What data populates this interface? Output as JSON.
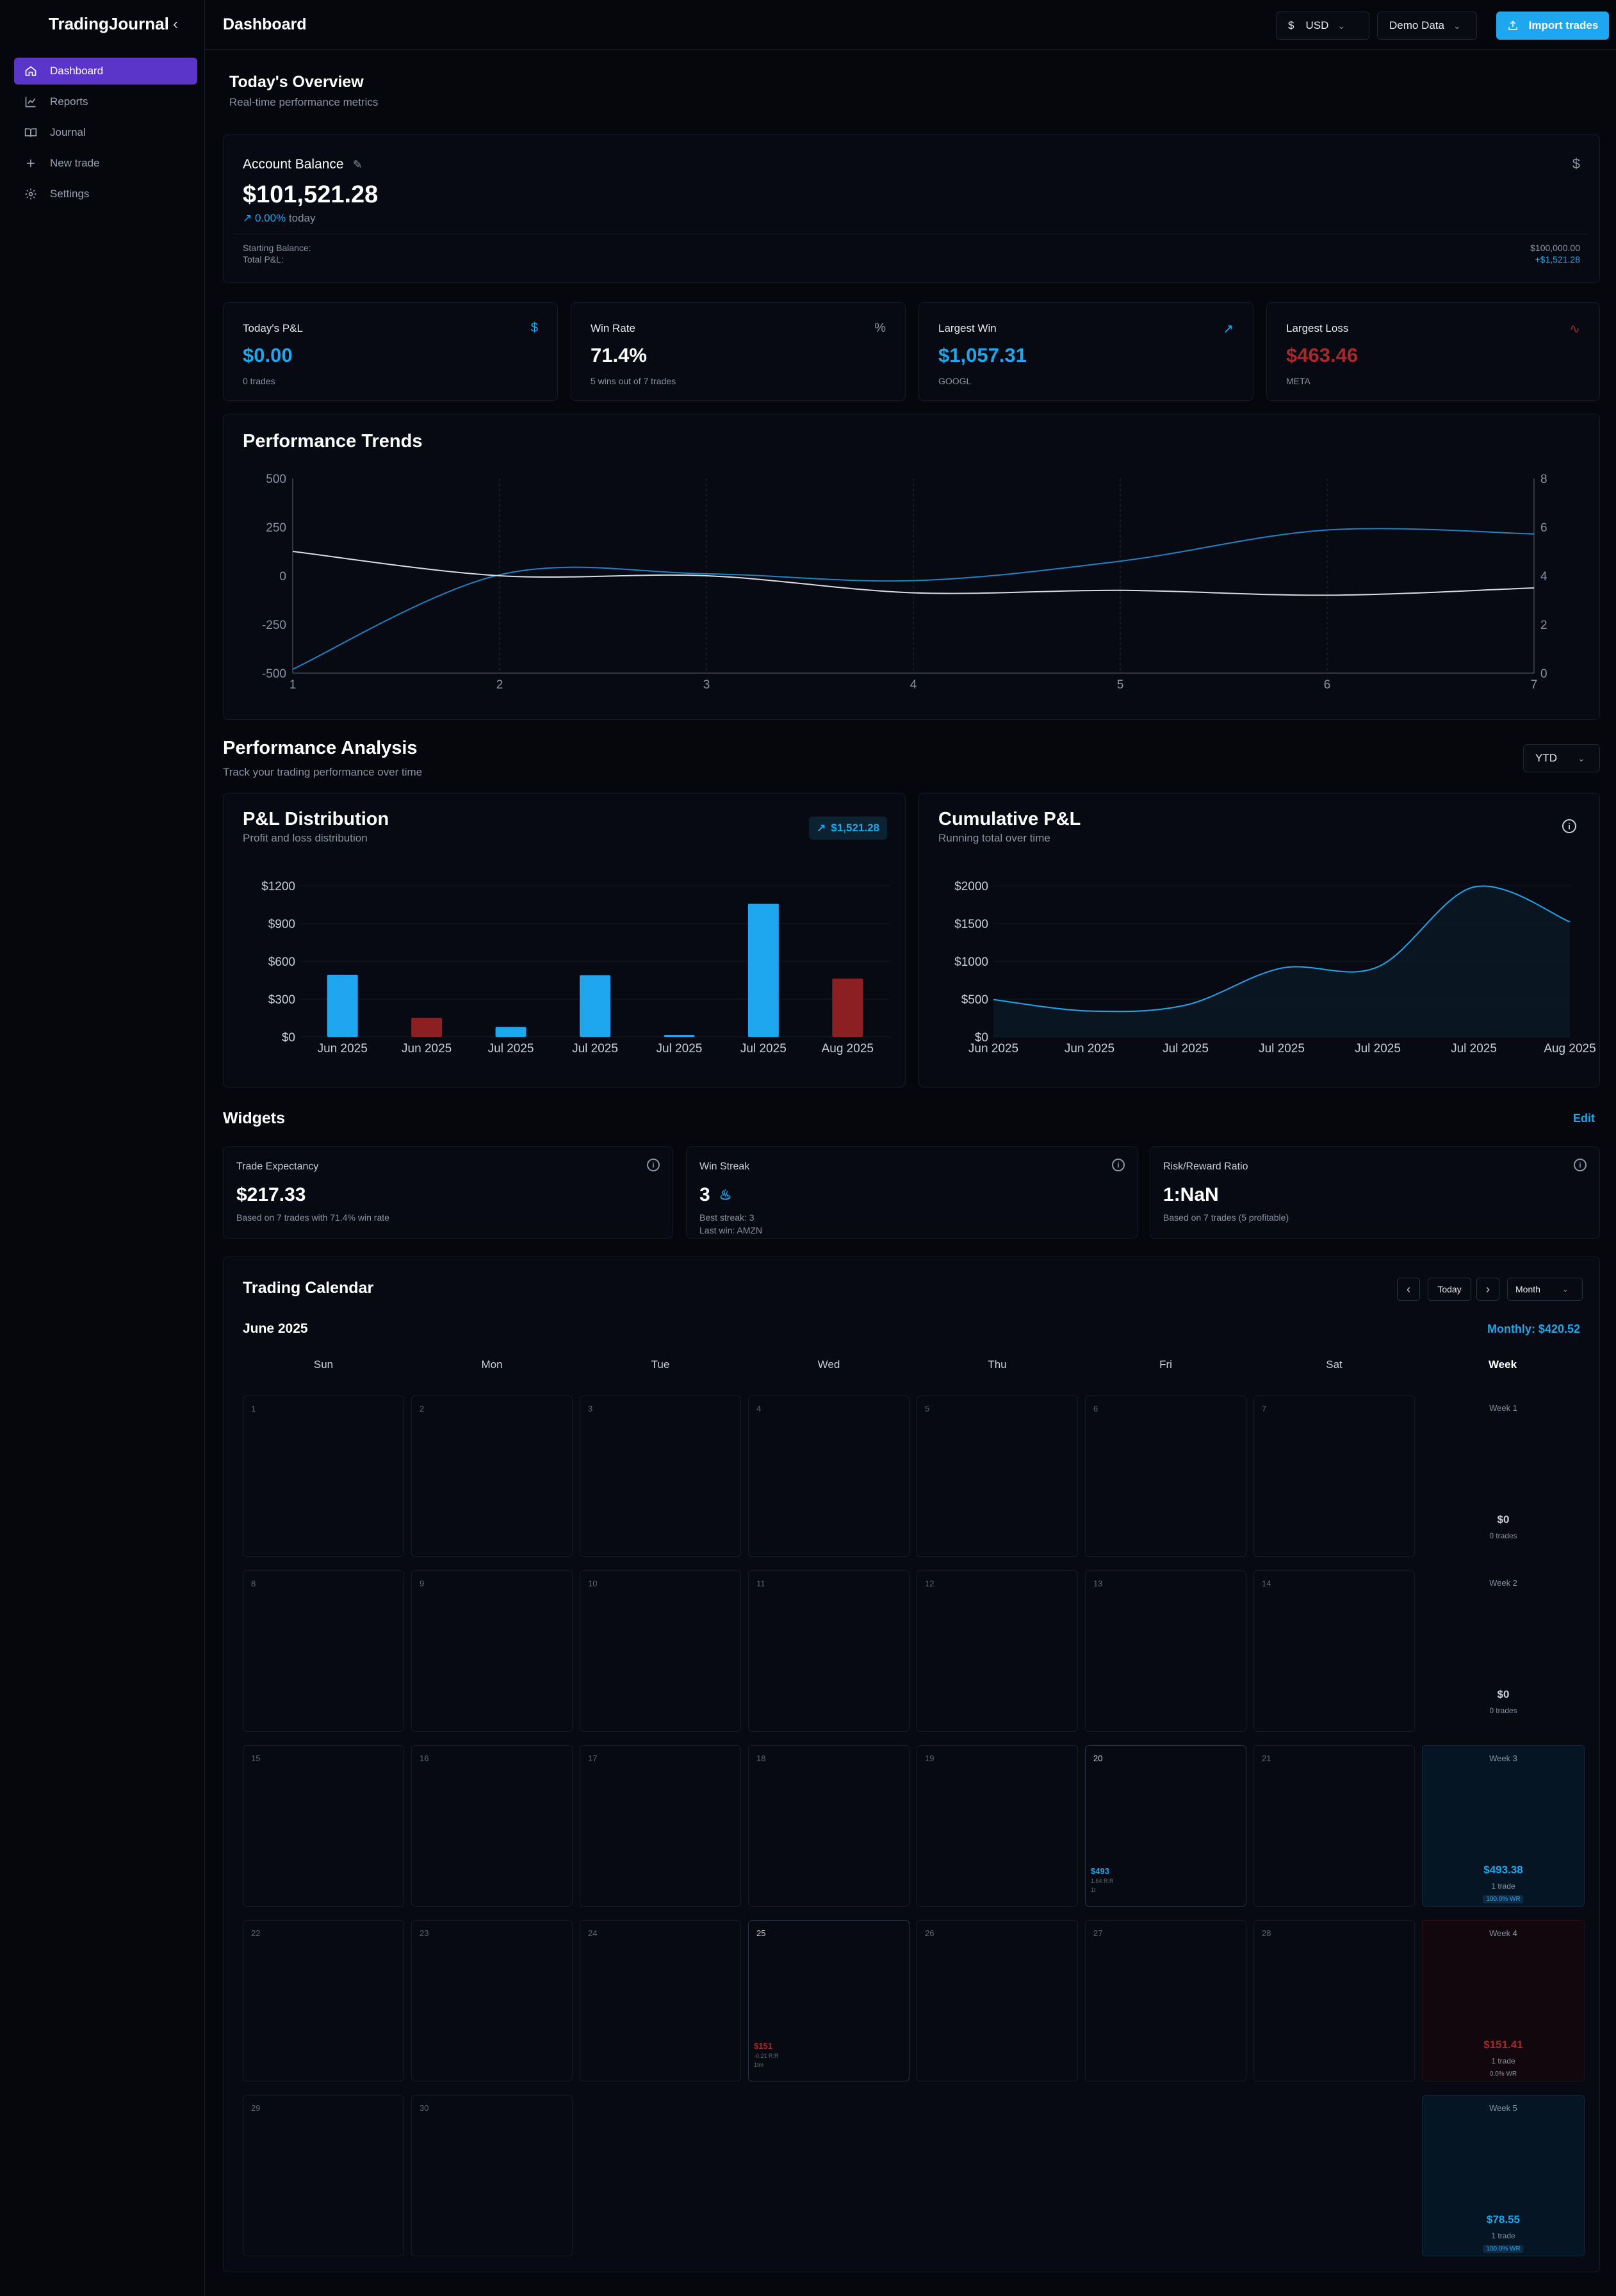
{
  "app": {
    "brand": "TradingJournal",
    "page_title": "Dashboard"
  },
  "sidebar": {
    "items": [
      {
        "label": "Dashboard",
        "icon": "home-icon",
        "active": true
      },
      {
        "label": "Reports",
        "icon": "chart-line-icon",
        "active": false
      },
      {
        "label": "Journal",
        "icon": "book-icon",
        "active": false
      },
      {
        "label": "New trade",
        "icon": "plus-icon",
        "active": false
      },
      {
        "label": "Settings",
        "icon": "gear-icon",
        "active": false
      }
    ]
  },
  "topbar": {
    "currency_symbol": "$",
    "currency": "USD",
    "data_source": "Demo Data",
    "import_label": "Import trades"
  },
  "overview": {
    "title": "Today's Overview",
    "subtitle": "Real-time performance metrics"
  },
  "account": {
    "label": "Account Balance",
    "balance": "$101,521.28",
    "change": "0.00%",
    "change_suffix": "today",
    "starting_label": "Starting Balance:",
    "starting_value": "$100,000.00",
    "pnl_label": "Total P&L:",
    "pnl_value": "+$1,521.28"
  },
  "stats": [
    {
      "label": "Today's P&L",
      "value": "$0.00",
      "sub": "0 trades",
      "icon_glyph": "$",
      "tone": "blue"
    },
    {
      "label": "Win Rate",
      "value": "71.4%",
      "sub": "5 wins out of 7 trades",
      "icon_glyph": "%",
      "tone": "white"
    },
    {
      "label": "Largest Win",
      "value": "$1,057.31",
      "sub": "GOOGL",
      "icon_glyph": "↗",
      "tone": "blue"
    },
    {
      "label": "Largest Loss",
      "value": "$463.46",
      "sub": "META",
      "icon_glyph": "∿",
      "tone": "red"
    }
  ],
  "trends": {
    "title": "Performance Trends",
    "chart_data": {
      "type": "line",
      "x": [
        1,
        2,
        3,
        4,
        5,
        6,
        7
      ],
      "xlim": [
        1,
        7
      ],
      "ylim_left": [
        -500,
        500
      ],
      "yticks_left": [
        "500",
        "250",
        "0",
        "-250",
        "-500"
      ],
      "ylim_right": [
        0,
        8
      ],
      "yticks_right": [
        "8",
        "6",
        "4",
        "2",
        "0"
      ],
      "xticks": [
        "1",
        "2",
        "3",
        "4",
        "5",
        "6",
        "7"
      ],
      "series": [
        {
          "axis": "left",
          "color": "#1d84c6",
          "values": [
            -480,
            5,
            10,
            -25,
            75,
            235,
            215
          ]
        },
        {
          "axis": "right",
          "color": "#d9dce3",
          "values": [
            5.0,
            4.0,
            4.0,
            3.3,
            3.4,
            3.2,
            3.5
          ]
        }
      ],
      "grid": "vertical dashed"
    }
  },
  "analysis": {
    "title": "Performance Analysis",
    "subtitle": "Track your trading performance over time",
    "range": "YTD"
  },
  "distribution": {
    "title": "P&L Distribution",
    "subtitle": "Profit and loss distribution",
    "badge": "$1,521.28",
    "chart_data": {
      "type": "bar",
      "categories": [
        "Jun 2025",
        "Jun 2025",
        "Jul 2025",
        "Jul 2025",
        "Jul 2025",
        "Jul 2025",
        "Aug 2025"
      ],
      "tick_labels": [
        "Jun 2025",
        "Jun 2025",
        "Jul 2025",
        "Jul 2025",
        "Jul 2025",
        "Jul 2025",
        "Aug 2025"
      ],
      "values": [
        493.38,
        -151.41,
        78.55,
        490,
        15,
        1057.31,
        -463.46
      ],
      "ylim": [
        0,
        1200
      ],
      "yticks": [
        "$1200",
        "$900",
        "$600",
        "$300",
        "$0"
      ],
      "colors": {
        "positive": "#1ea7ee",
        "negative": "#8b1f22"
      }
    }
  },
  "cumulative": {
    "title": "Cumulative P&L",
    "subtitle": "Running total over time",
    "chart_data": {
      "type": "area",
      "x": [
        "Jun 2025",
        "Jun 2025",
        "Jul 2025",
        "Jul 2025",
        "Jul 2025",
        "Jul 2025",
        "Aug 2025"
      ],
      "tick_labels": [
        "Jun 2025",
        "Jun 2025",
        "Jul 2025",
        "Jul 2025",
        "Jul 2025",
        "Jul 2025",
        "Aug 2025"
      ],
      "values": [
        493.38,
        341.97,
        420.52,
        910.52,
        925.52,
        1982.83,
        1521.28
      ],
      "ylim": [
        0,
        2000
      ],
      "yticks": [
        "$2000",
        "$1500",
        "$1000",
        "$500",
        "$0"
      ],
      "color": "#1ea7ee"
    }
  },
  "widgets": {
    "title": "Widgets",
    "edit_label": "Edit",
    "items": [
      {
        "label": "Trade Expectancy",
        "value": "$217.33",
        "lines": [
          "Based on 7 trades with 71.4% win rate"
        ]
      },
      {
        "label": "Win Streak",
        "value": "3",
        "lines": [
          "Best streak: 3",
          "Last win: AMZN"
        ]
      },
      {
        "label": "Risk/Reward Ratio",
        "value": "1:NaN",
        "lines": [
          "Based on 7 trades (5 profitable)"
        ]
      }
    ]
  },
  "calendar": {
    "title": "Trading Calendar",
    "today_label": "Today",
    "view": "Month",
    "month": "June 2025",
    "monthly_label": "Monthly: $420.52",
    "weekdays": [
      "Sun",
      "Mon",
      "Tue",
      "Wed",
      "Thu",
      "Fri",
      "Sat",
      "Week"
    ],
    "days": [
      "1",
      "2",
      "3",
      "4",
      "5",
      "6",
      "7",
      "8",
      "9",
      "10",
      "11",
      "12",
      "13",
      "14",
      "15",
      "16",
      "17",
      "18",
      "19",
      "20",
      "21",
      "22",
      "23",
      "24",
      "25",
      "26",
      "27",
      "28",
      "29",
      "30"
    ],
    "day_entries": [
      {
        "day": "20",
        "amount": "$493",
        "r": "1.64 R:R",
        "note": "1t",
        "tone": "blue"
      },
      {
        "day": "25",
        "amount": "$151",
        "r": "-0.21 R:R",
        "note": "1tm",
        "tone": "red"
      }
    ],
    "weeks": [
      {
        "label": "Week 1",
        "value": "$0",
        "trades": "0 trades",
        "badge": "",
        "tone": "neutral"
      },
      {
        "label": "Week 2",
        "value": "$0",
        "trades": "0 trades",
        "badge": "",
        "tone": "neutral"
      },
      {
        "label": "Week 3",
        "value": "$493.38",
        "trades": "1 trade",
        "badge": "100.0% WR",
        "tone": "blue"
      },
      {
        "label": "Week 4",
        "value": "$151.41",
        "trades": "1 trade",
        "badge": "0.0% WR",
        "tone": "red"
      },
      {
        "label": "Week 5",
        "value": "$78.55",
        "trades": "1 trade",
        "badge": "100.0% WR",
        "tone": "blue"
      }
    ]
  }
}
